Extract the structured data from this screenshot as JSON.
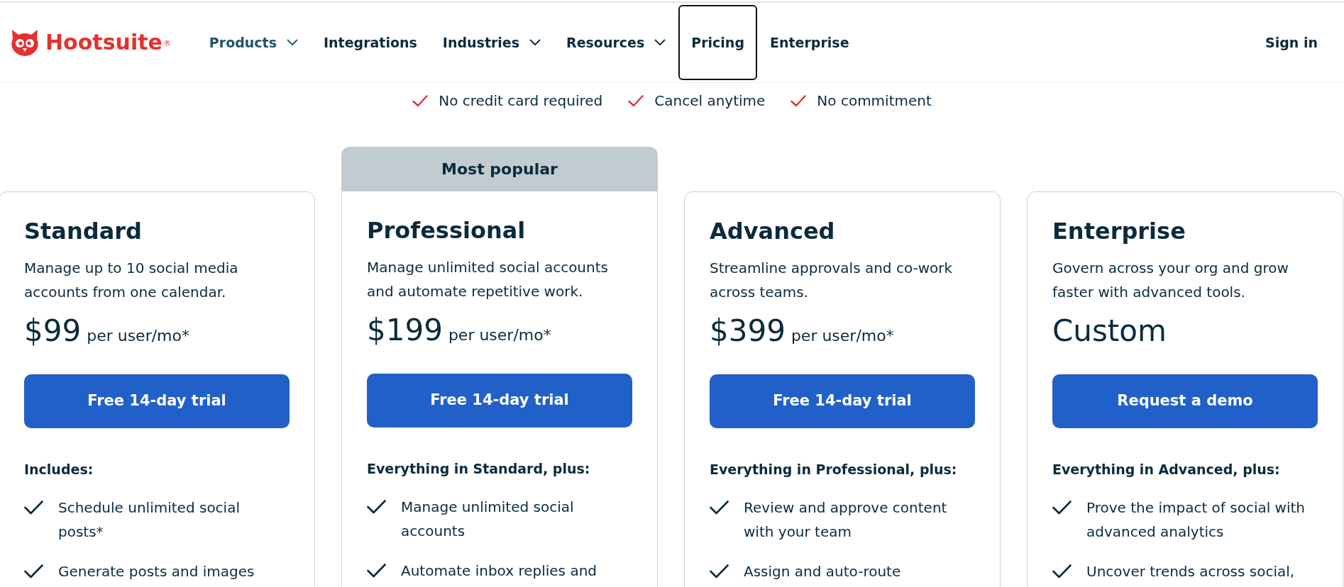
{
  "header": {
    "logo": "Hootsuite$^{®}$",
    "nav": [
      {
        "label": "Products",
        "has_menu": true,
        "hovered": true,
        "focused": false
      },
      {
        "label": "Integrations",
        "has_menu": false,
        "hovered": false,
        "focused": false
      },
      {
        "label": "Industries",
        "has_menu": true,
        "hovered": false,
        "focused": false
      },
      {
        "label": "Resources",
        "has_menu": true,
        "hovered": false,
        "focused": false
      },
      {
        "label": "Pricing",
        "has_menu": false,
        "hovered": false,
        "focused": true
      },
      {
        "label": "Enterprise",
        "has_menu": false,
        "hovered": false,
        "focused": false
      }
    ],
    "sign_in": "Sign in"
  },
  "benefits": [
    "No credit card required",
    "Cancel anytime",
    "No commitment"
  ],
  "plans": [
    {
      "name": "Standard",
      "description": "Manage up to 10 social media accounts from one calendar.",
      "price": "$99",
      "price_unit": "per user/mo*",
      "cta": "Free 14-day trial",
      "features_heading": "Includes:",
      "features": [
        "Schedule unlimited social posts*",
        "Generate posts and images"
      ]
    },
    {
      "badge": "Most popular",
      "name": "Professional",
      "description": "Manage unlimited social accounts and automate repetitive work.",
      "price": "$199",
      "price_unit": "per user/mo*",
      "cta": "Free 14-day trial",
      "features_heading": "Everything in Standard, plus:",
      "features": [
        "Manage unlimited social accounts",
        "Automate inbox replies and"
      ]
    },
    {
      "name": "Advanced",
      "description": "Streamline approvals and co-work across teams.",
      "price": "$399",
      "price_unit": "per user/mo*",
      "cta": "Free 14-day trial",
      "features_heading": "Everything in Professional, plus:",
      "features": [
        "Review and approve content with your team",
        "Assign and auto-route"
      ]
    },
    {
      "name": "Enterprise",
      "description": "Govern across your org and grow faster with advanced tools.",
      "price": "Custom",
      "cta": "Request a demo",
      "features_heading": "Everything in Advanced, plus:",
      "features": [
        "Prove the impact of social with advanced analytics",
        "Uncover trends across social,"
      ]
    }
  ]
}
